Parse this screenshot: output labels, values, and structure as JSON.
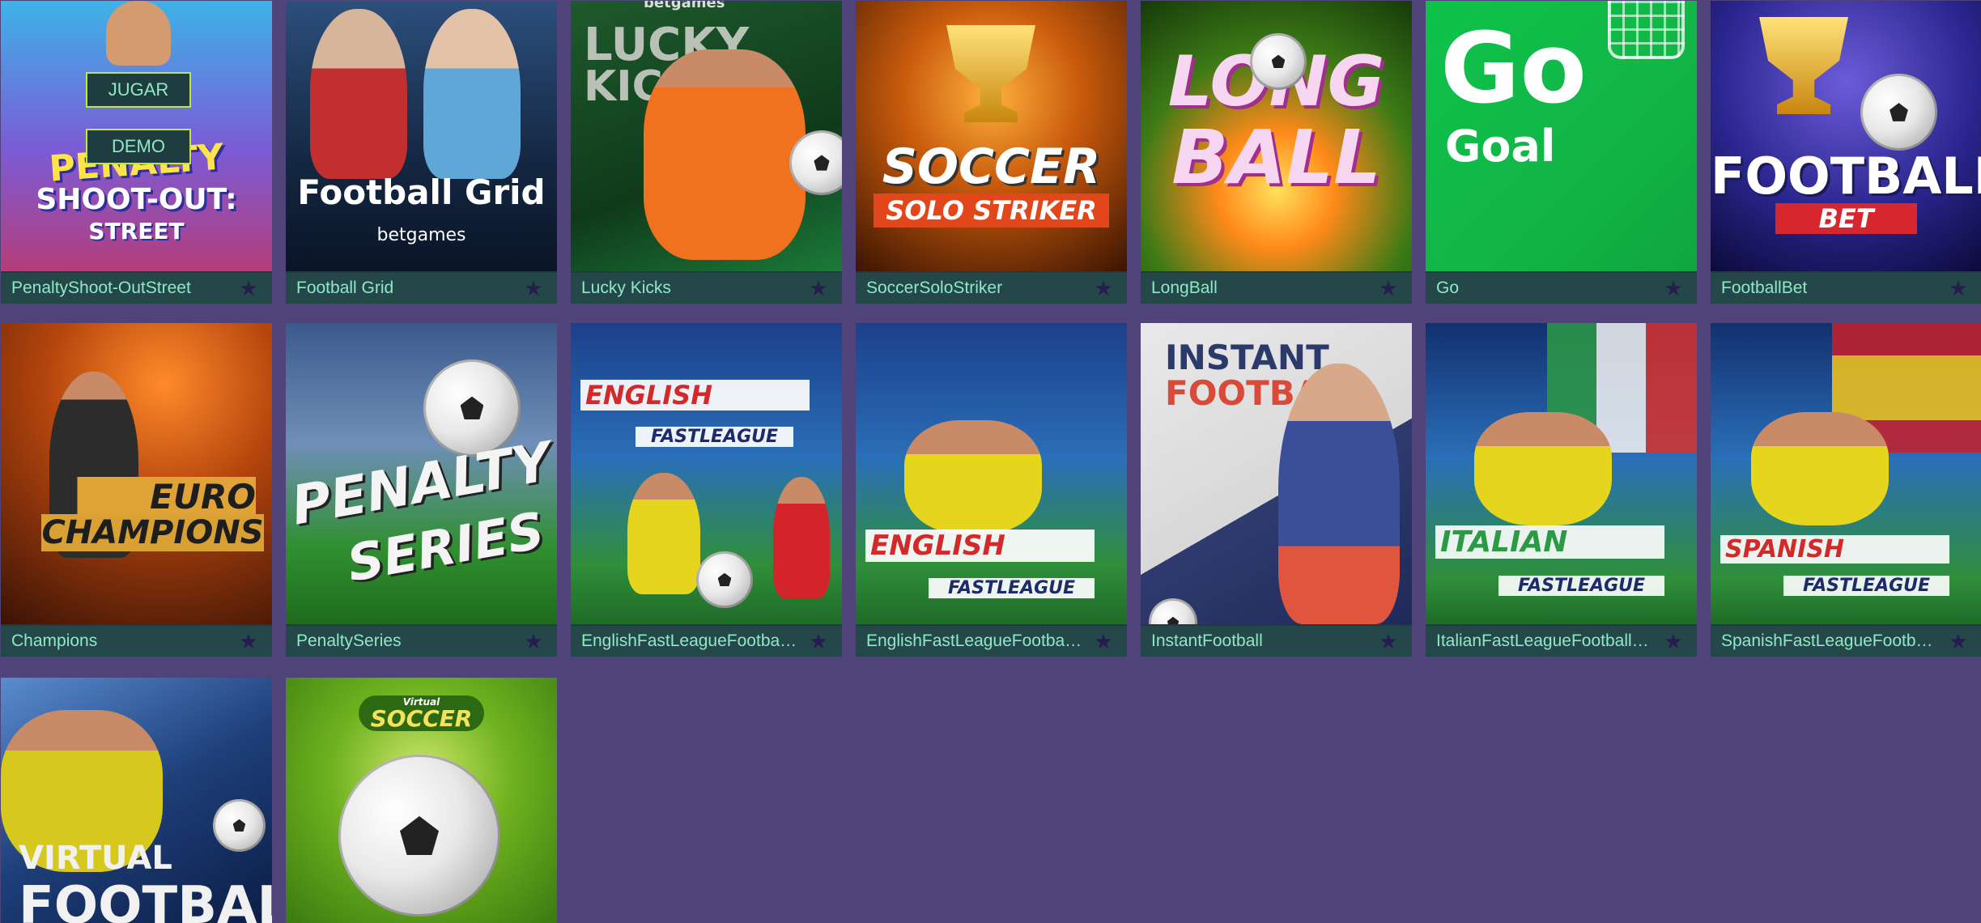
{
  "controls": {
    "play_label": "JUGAR",
    "demo_label": "DEMO"
  },
  "games": [
    {
      "label": "PenaltyShoot-OutStreet",
      "art": [
        "PENALTY",
        "SHOOT-OUT:",
        "STREET"
      ]
    },
    {
      "label": "Football Grid",
      "art": [
        "Football Grid",
        "betgames"
      ]
    },
    {
      "label": "Lucky Kicks",
      "art": [
        "LUCKY",
        "KICKS",
        "betgames"
      ]
    },
    {
      "label": "SoccerSoloStriker",
      "art": [
        "SOCCER",
        "SOLO STRIKER"
      ]
    },
    {
      "label": "LongBall",
      "art": [
        "LONG",
        "BALL"
      ]
    },
    {
      "label": "Go",
      "art": [
        "Go",
        "Goal"
      ]
    },
    {
      "label": "FootballBet",
      "art": [
        "FOOTBALL",
        "BET"
      ]
    },
    {
      "label": "Champions",
      "art": [
        "EURO",
        "CHAMPIONS"
      ]
    },
    {
      "label": "PenaltySeries",
      "art": [
        "PENALTY",
        "SERIES"
      ]
    },
    {
      "label": "EnglishFastLeagueFootbal…",
      "art": [
        "ENGLISH",
        "FASTLEAGUE"
      ]
    },
    {
      "label": "EnglishFastLeagueFootbal…",
      "art": [
        "ENGLISH",
        "FASTLEAGUE"
      ]
    },
    {
      "label": "InstantFootball",
      "art": [
        "INSTANT",
        "FOOTBALL"
      ]
    },
    {
      "label": "ItalianFastLeagueFootball…",
      "art": [
        "ITALIAN",
        "FASTLEAGUE"
      ]
    },
    {
      "label": "SpanishFastLeagueFootb…",
      "art": [
        "SPANISH",
        "FASTLEAGUE"
      ]
    },
    {
      "label": "",
      "art": [
        "VIRTUAL",
        "FOOTBALL"
      ]
    },
    {
      "label": "",
      "art": [
        "Virtual",
        "SOCCER"
      ]
    }
  ],
  "colors": {
    "background": "#4e4479",
    "label_bar": "#24474a",
    "label_text": "#8ee9c4",
    "star": "#241d4d"
  },
  "icons": {
    "favorite": "star-icon"
  }
}
